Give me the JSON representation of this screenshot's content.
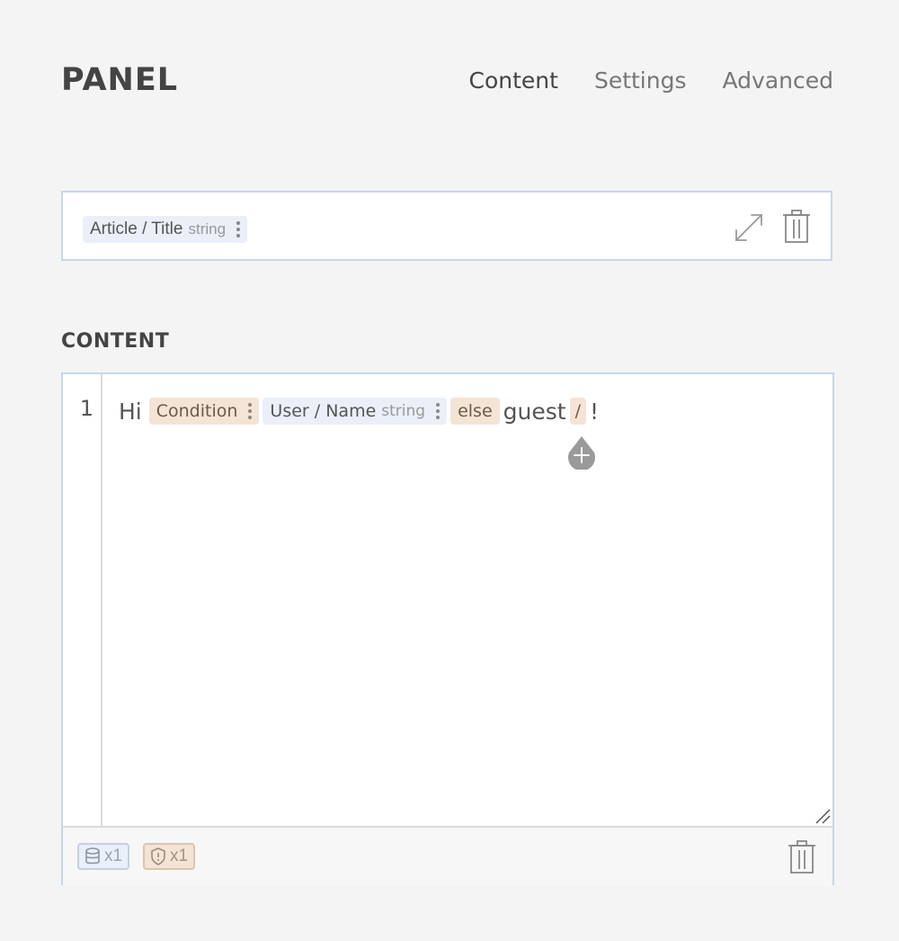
{
  "header": {
    "title": "PANEL",
    "tabs": [
      {
        "label": "Content",
        "active": true
      },
      {
        "label": "Settings",
        "active": false
      },
      {
        "label": "Advanced",
        "active": false
      }
    ]
  },
  "title_field": {
    "chip_label": "Article / Title",
    "chip_type": "string",
    "icons": [
      "expand-icon",
      "trash-icon"
    ]
  },
  "content": {
    "section_label": "CONTENT",
    "line_number": "1",
    "line": {
      "text_hi": "Hi",
      "condition_label": "Condition",
      "var_label": "User / Name",
      "var_type": "string",
      "else_label": "else",
      "text_guest": "guest",
      "end_label": "/",
      "text_bang": "!"
    },
    "footer": {
      "source_count": "x1",
      "condition_count": "x1",
      "icons": [
        "database-icon",
        "shield-icon",
        "trash-icon"
      ]
    }
  },
  "colors": {
    "border": "#c9d6ea",
    "chip_blue": "#eaeff8",
    "chip_orange": "#f3e4d5",
    "add_handle": "#9a9a9a"
  }
}
